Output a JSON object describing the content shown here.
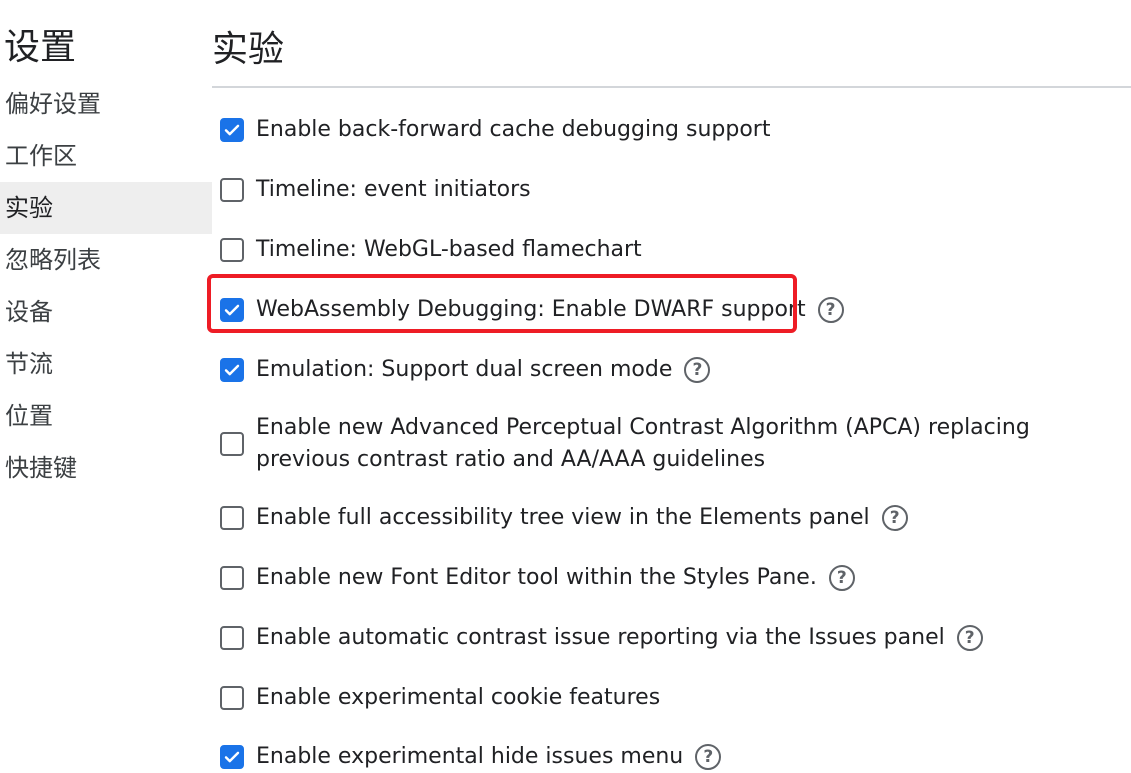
{
  "sidebar": {
    "title": "设置",
    "items": [
      {
        "label": "偏好设置",
        "active": false
      },
      {
        "label": "工作区",
        "active": false
      },
      {
        "label": "实验",
        "active": true
      },
      {
        "label": "忽略列表",
        "active": false
      },
      {
        "label": "设备",
        "active": false
      },
      {
        "label": "节流",
        "active": false
      },
      {
        "label": "位置",
        "active": false
      },
      {
        "label": "快捷键",
        "active": false
      }
    ]
  },
  "main": {
    "title": "实验",
    "help_glyph": "?",
    "experiments": [
      {
        "label": "Enable back-forward cache debugging support",
        "checked": true,
        "help": false
      },
      {
        "label": "Timeline: event initiators",
        "checked": false,
        "help": false
      },
      {
        "label": "Timeline: WebGL-based flamechart",
        "checked": false,
        "help": false
      },
      {
        "label": "WebAssembly Debugging: Enable DWARF support",
        "checked": true,
        "help": true
      },
      {
        "label": "Emulation: Support dual screen mode",
        "checked": true,
        "help": true
      },
      {
        "label": "Enable new Advanced Perceptual Contrast Algorithm (APCA) replacing previous contrast ratio and AA/AAA guidelines",
        "checked": false,
        "help": false
      },
      {
        "label": "Enable full accessibility tree view in the Elements panel",
        "checked": false,
        "help": true
      },
      {
        "label": "Enable new Font Editor tool within the Styles Pane.",
        "checked": false,
        "help": true
      },
      {
        "label": "Enable automatic contrast issue reporting via the Issues panel",
        "checked": false,
        "help": true
      },
      {
        "label": "Enable experimental cookie features",
        "checked": false,
        "help": false
      },
      {
        "label": "Enable experimental hide issues menu",
        "checked": true,
        "help": true
      }
    ]
  },
  "colors": {
    "accent": "#1a73e8",
    "highlight": "#ee1c25"
  }
}
